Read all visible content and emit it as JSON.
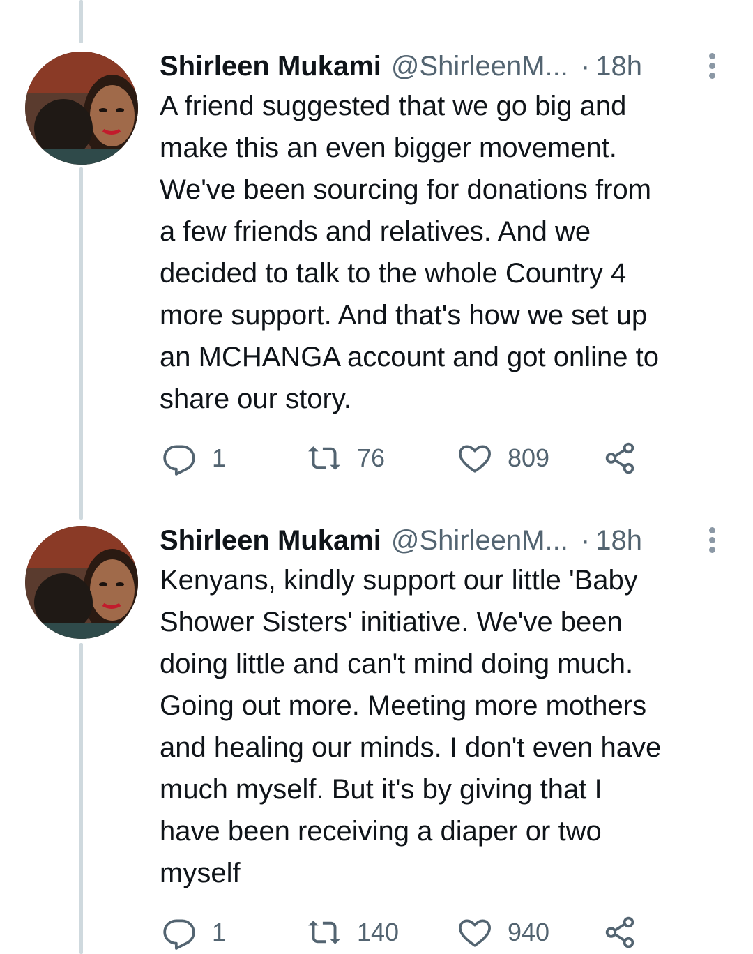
{
  "tweets": [
    {
      "author_name": "Shirleen Mukami",
      "handle": "@ShirleenM...",
      "separator": "·",
      "time": "18h",
      "body_lines": [
        "A friend suggested that we go big and",
        "make this an even bigger movement.",
        "We've been sourcing for donations from",
        "a few friends and relatives. And we",
        "decided to talk to the whole Country 4",
        "more support. And that's how we set up",
        "an MCHANGA account and got online to",
        "share our story."
      ],
      "replies": "1",
      "retweets": "76",
      "likes": "809"
    },
    {
      "author_name": "Shirleen Mukami",
      "handle": "@ShirleenM...",
      "separator": "·",
      "time": "18h",
      "body_lines": [
        "Kenyans, kindly support our little 'Baby",
        "Shower Sisters' initiative. We've been",
        "doing little and can't mind doing much.",
        "Going out more. Meeting more mothers",
        "and healing our minds. I don't even have",
        "much myself. But it's by giving that I",
        "have been receiving a diaper or two",
        "myself"
      ],
      "replies": "1",
      "retweets": "140",
      "likes": "940"
    }
  ],
  "icons": {
    "reply": "reply-icon",
    "retweet": "retweet-icon",
    "like": "heart-icon",
    "share": "share-icon",
    "more": "more-options-icon"
  },
  "colors": {
    "text": "#0f1419",
    "secondary": "#536471",
    "thread_line": "#cfd9de"
  }
}
